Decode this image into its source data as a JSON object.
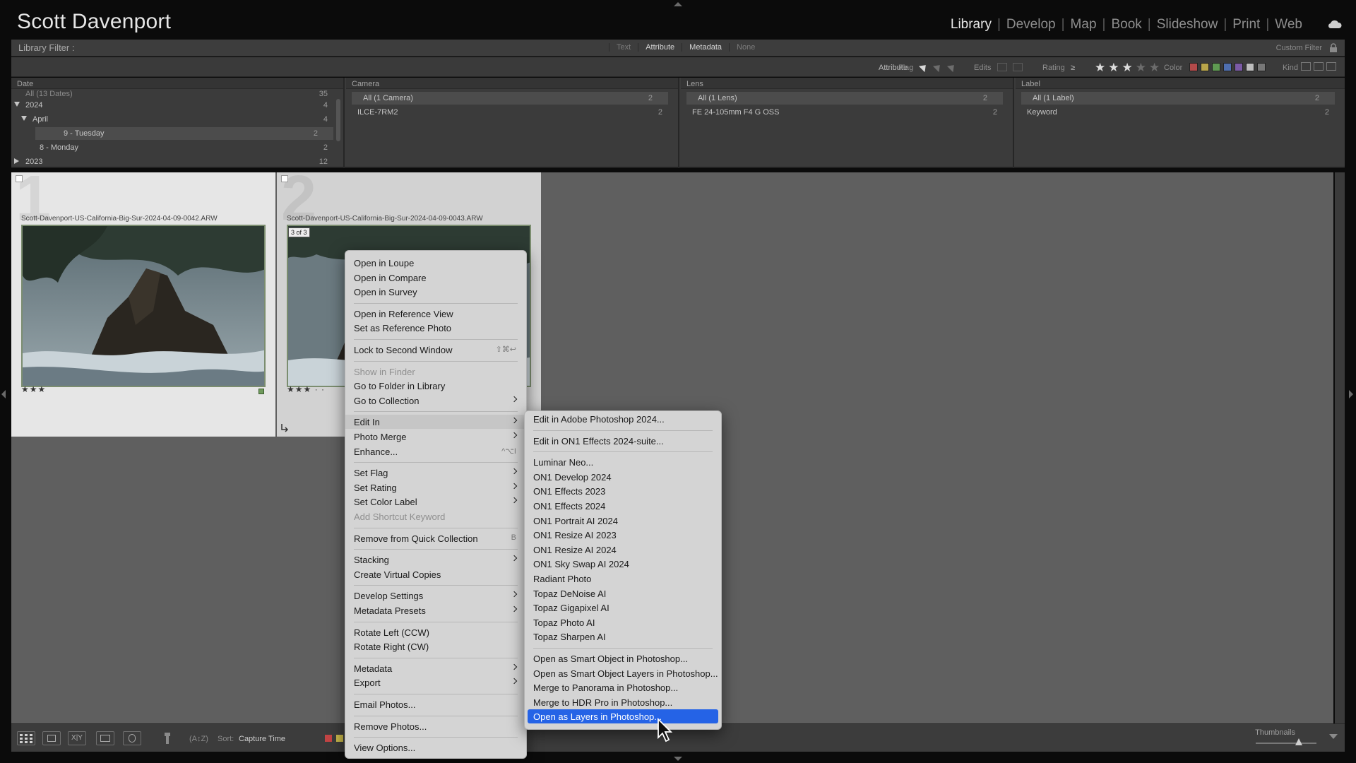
{
  "identity_plate": "Scott Davenport",
  "modules": [
    {
      "label": "Library",
      "active": true
    },
    {
      "label": "Develop",
      "active": false
    },
    {
      "label": "Map",
      "active": false
    },
    {
      "label": "Book",
      "active": false
    },
    {
      "label": "Slideshow",
      "active": false
    },
    {
      "label": "Print",
      "active": false
    },
    {
      "label": "Web",
      "active": false
    }
  ],
  "filter_bar": {
    "title": "Library Filter :",
    "tabs": [
      {
        "label": "Text",
        "on": false
      },
      {
        "label": "Attribute",
        "on": true
      },
      {
        "label": "Metadata",
        "on": true
      },
      {
        "label": "None",
        "on": false
      }
    ],
    "custom_filter": "Custom Filter"
  },
  "attribute_bar": {
    "attribute": "Attribute",
    "flag": "Flag",
    "edits": "Edits",
    "rating": "Rating",
    "rating_op": "≥",
    "rating_value": 3,
    "rating_max": 5,
    "color": "Color",
    "kind": "Kind",
    "swatches": [
      "#b34a4a",
      "#b9a54a",
      "#5f9a52",
      "#4f6fb0",
      "#7b5aa5",
      "#bdbdbd",
      "#777777"
    ]
  },
  "browser": {
    "date": {
      "header": "Date",
      "rows": [
        {
          "label": "All (13 Dates)",
          "count": "35"
        },
        {
          "label": "2024",
          "count": "4"
        },
        {
          "label": "April",
          "count": "4"
        },
        {
          "label": "9 - Tuesday",
          "count": "2"
        },
        {
          "label": "8 - Monday",
          "count": "2"
        },
        {
          "label": "2023",
          "count": "12"
        }
      ]
    },
    "camera": {
      "header": "Camera",
      "rows": [
        {
          "label": "All (1 Camera)",
          "count": "2"
        },
        {
          "label": "ILCE-7RM2",
          "count": "2"
        }
      ]
    },
    "lens": {
      "header": "Lens",
      "rows": [
        {
          "label": "All (1 Lens)",
          "count": "2"
        },
        {
          "label": "FE 24-105mm F4 G OSS",
          "count": "2"
        }
      ]
    },
    "label": {
      "header": "Label",
      "rows": [
        {
          "label": "All (1 Label)",
          "count": "2"
        },
        {
          "label": "Keyword",
          "count": "2"
        }
      ]
    }
  },
  "grid": {
    "photos": [
      {
        "index": "1",
        "filename": "Scott-Davenport-US-California-Big-Sur-2024-04-09-0042.ARW",
        "stars": "★★★"
      },
      {
        "index": "2",
        "filename": "Scott-Davenport-US-California-Big-Sur-2024-04-09-0043.ARW",
        "stars": "★★★ · ·",
        "badge": "3 of 3"
      }
    ]
  },
  "toolbar": {
    "sort_label": "Sort:",
    "sort_value": "Capture Time",
    "thumbnails_label": "Thumbnails"
  },
  "context_menu": {
    "items": [
      {
        "label": "Open in Loupe"
      },
      {
        "label": "Open in Compare"
      },
      {
        "label": "Open in Survey"
      },
      {
        "sep": true
      },
      {
        "label": "Open in Reference View"
      },
      {
        "label": "Set as Reference Photo"
      },
      {
        "sep": true
      },
      {
        "label": "Lock to Second Window",
        "shortcut": "⇧⌘↩"
      },
      {
        "sep": true
      },
      {
        "label": "Show in Finder",
        "disabled": true
      },
      {
        "label": "Go to Folder in Library"
      },
      {
        "label": "Go to Collection",
        "submenu": true
      },
      {
        "sep": true
      },
      {
        "label": "Edit In",
        "submenu": true,
        "highlight": true
      },
      {
        "label": "Photo Merge",
        "submenu": true
      },
      {
        "label": "Enhance...",
        "shortcut": "^⌥I"
      },
      {
        "sep": true
      },
      {
        "label": "Set Flag",
        "submenu": true
      },
      {
        "label": "Set Rating",
        "submenu": true
      },
      {
        "label": "Set Color Label",
        "submenu": true
      },
      {
        "label": "Add Shortcut Keyword",
        "disabled": true
      },
      {
        "sep": true
      },
      {
        "label": "Remove from Quick Collection",
        "shortcut": "B"
      },
      {
        "sep": true
      },
      {
        "label": "Stacking",
        "submenu": true
      },
      {
        "label": "Create Virtual Copies"
      },
      {
        "sep": true
      },
      {
        "label": "Develop Settings",
        "submenu": true
      },
      {
        "label": "Metadata Presets",
        "submenu": true
      },
      {
        "sep": true
      },
      {
        "label": "Rotate Left (CCW)"
      },
      {
        "label": "Rotate Right (CW)"
      },
      {
        "sep": true
      },
      {
        "label": "Metadata",
        "submenu": true
      },
      {
        "label": "Export",
        "submenu": true
      },
      {
        "sep": true
      },
      {
        "label": "Email Photos..."
      },
      {
        "sep": true
      },
      {
        "label": "Remove Photos..."
      },
      {
        "sep": true
      },
      {
        "label": "View Options..."
      }
    ]
  },
  "edit_in_submenu": {
    "items": [
      {
        "label": "Edit in Adobe Photoshop 2024..."
      },
      {
        "sep": true
      },
      {
        "label": "Edit in ON1 Effects 2024-suite..."
      },
      {
        "sep": true
      },
      {
        "label": "Luminar Neo..."
      },
      {
        "label": "ON1 Develop 2024"
      },
      {
        "label": "ON1 Effects 2023"
      },
      {
        "label": "ON1 Effects 2024"
      },
      {
        "label": "ON1 Portrait AI 2024"
      },
      {
        "label": "ON1 Resize AI 2023"
      },
      {
        "label": "ON1 Resize AI 2024"
      },
      {
        "label": "ON1 Sky Swap AI 2024"
      },
      {
        "label": "Radiant Photo"
      },
      {
        "label": "Topaz DeNoise AI"
      },
      {
        "label": "Topaz Gigapixel AI"
      },
      {
        "label": "Topaz Photo AI"
      },
      {
        "label": "Topaz Sharpen AI"
      },
      {
        "sep": true
      },
      {
        "label": "Open as Smart Object in Photoshop..."
      },
      {
        "label": "Open as Smart Object Layers in Photoshop..."
      },
      {
        "label": "Merge to Panorama in Photoshop..."
      },
      {
        "label": "Merge to HDR Pro in Photoshop..."
      },
      {
        "label": "Open as Layers in Photoshop...",
        "active": true
      }
    ]
  }
}
